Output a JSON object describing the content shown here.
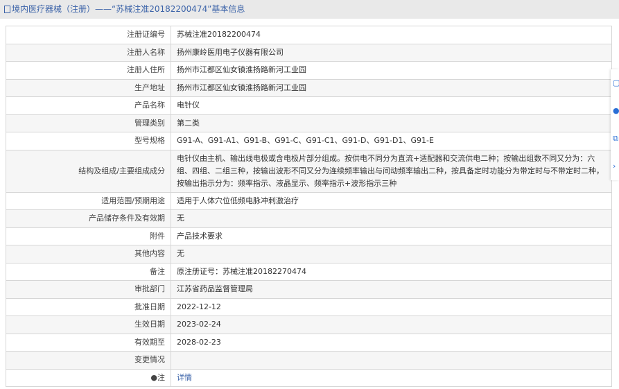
{
  "header": {
    "title": "境内医疗器械（注册）——“苏械注准20182200474”基本信息"
  },
  "rows": [
    {
      "label": "注册证编号",
      "value": "苏械注准20182200474"
    },
    {
      "label": "注册人名称",
      "value": "扬州康岭医用电子仪器有限公司"
    },
    {
      "label": "注册人住所",
      "value": "扬州市江都区仙女镇淮扬路新河工业园"
    },
    {
      "label": "生产地址",
      "value": "扬州市江都区仙女镇淮扬路新河工业园"
    },
    {
      "label": "产品名称",
      "value": "电针仪"
    },
    {
      "label": "管理类别",
      "value": "第二类"
    },
    {
      "label": "型号规格",
      "value": "G91-A、G91-A1、G91-B、G91-C、G91-C1、G91-D、G91-D1、G91-E"
    },
    {
      "label": "结构及组成/主要组成成分",
      "value": "电针仪由主机、输出线电极或含电极片部分组成。按供电不同分为直流+适配器和交流供电二种；按输出组数不同又分为：六组、四组、二组三种，按输出波形不同又分为连续频率输出与间动频率输出二种，按具备定时功能分为带定时与不带定时二种，按输出指示分为：频率指示、液晶显示、频率指示+波形指示三种"
    },
    {
      "label": "适用范围/预期用途",
      "value": "适用于人体穴位低频电脉冲刺激治疗"
    },
    {
      "label": "产品储存条件及有效期",
      "value": "无"
    },
    {
      "label": "附件",
      "value": "产品技术要求"
    },
    {
      "label": "其他内容",
      "value": "无"
    },
    {
      "label": "备注",
      "value": "原注册证号：苏械注准20182270474"
    },
    {
      "label": "审批部门",
      "value": "江苏省药品监督管理局"
    },
    {
      "label": "批准日期",
      "value": "2022-12-12"
    },
    {
      "label": "生效日期",
      "value": "2023-02-24"
    },
    {
      "label": "有效期至",
      "value": "2028-02-23"
    },
    {
      "label": "变更情况",
      "value": ""
    }
  ],
  "note": {
    "label": "注",
    "link": "详情"
  },
  "side_icons": [
    "document-icon",
    "info-icon",
    "cube-icon",
    "chevron-right-icon"
  ]
}
